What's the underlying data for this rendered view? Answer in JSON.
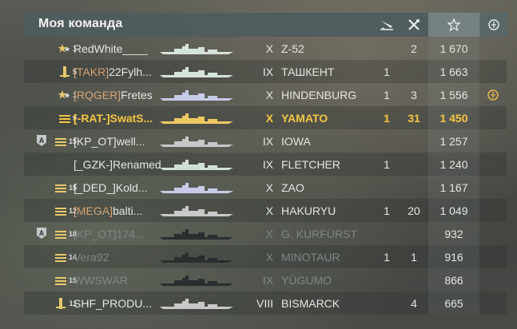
{
  "header": {
    "title": "Моя команда",
    "columns": [
      "torpedo-hits-icon",
      "kills-icon",
      "experience-star-icon",
      "achievement-icon"
    ]
  },
  "colors": {
    "player_highlight": "#f5c542",
    "clan_orange": "#d5a373",
    "dead_text": "#7d8788",
    "header_bg": "#4e5c5e"
  },
  "rows": [
    {
      "rank": "1",
      "clan": "",
      "player": "RedWhite____",
      "tier": "X",
      "ship": "Z-52",
      "torp": "",
      "kills": "2",
      "xp": "1 670",
      "ach": ""
    },
    {
      "rank": "5",
      "clan": "[TAKR]",
      "player": "22Fylh...",
      "tier": "IX",
      "ship": "ТАШКЕНТ",
      "torp": "1",
      "kills": "",
      "xp": "1 663",
      "ach": ""
    },
    {
      "rank": "1",
      "clan": "[RQGER]",
      "player": "Fretes",
      "tier": "X",
      "ship": "HINDENBURG",
      "torp": "1",
      "kills": "3",
      "xp": "1 556",
      "ach": "medal"
    },
    {
      "rank": "9",
      "clan": "[-RAT-]",
      "player": "SwatS...",
      "tier": "X",
      "ship": "YAMATO",
      "torp": "1",
      "kills": "31",
      "xp": "1 450",
      "ach": ""
    },
    {
      "rank": "15",
      "clan": "[KP_OT]",
      "player": "well...",
      "tier": "IX",
      "ship": "IOWA",
      "torp": "",
      "kills": "",
      "xp": "1 257",
      "ach": ""
    },
    {
      "rank": "",
      "clan": "[_GZK-]",
      "player": "RenamedU...",
      "tier": "IX",
      "ship": "FLETCHER",
      "torp": "1",
      "kills": "",
      "xp": "1 240",
      "ach": ""
    },
    {
      "rank": "15",
      "clan": "[_DED_]",
      "player": "Kold...",
      "tier": "X",
      "ship": "ZAO",
      "torp": "",
      "kills": "",
      "xp": "1 167",
      "ach": ""
    },
    {
      "rank": "12",
      "clan": "[MEGA]",
      "player": "balti...",
      "tier": "X",
      "ship": "HAKURYU",
      "torp": "1",
      "kills": "20",
      "xp": "1 049",
      "ach": ""
    },
    {
      "rank": "18",
      "clan": "[KP_OT]",
      "player": "174...",
      "tier": "X",
      "ship": "G. KURFÜRST",
      "torp": "",
      "kills": "",
      "xp": "932",
      "ach": ""
    },
    {
      "rank": "14",
      "clan": "",
      "player": "Vera92",
      "tier": "X",
      "ship": "MINOTAUR",
      "torp": "1",
      "kills": "1",
      "xp": "916",
      "ach": ""
    },
    {
      "rank": "15",
      "clan": "",
      "player": "WWSWAR",
      "tier": "IX",
      "ship": "YŪGUMO",
      "torp": "",
      "kills": "",
      "xp": "866",
      "ach": ""
    },
    {
      "rank": "11",
      "clan": "",
      "player": "SHF_PRODU...",
      "tier": "VIII",
      "ship": "BISMARCK",
      "torp": "",
      "kills": "4",
      "xp": "665",
      "ach": ""
    }
  ]
}
